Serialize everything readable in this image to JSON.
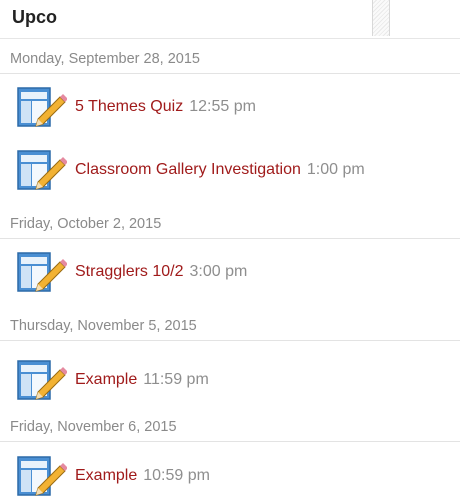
{
  "header": {
    "title": "Upco"
  },
  "groups": [
    {
      "date": "Monday, September 28, 2015",
      "events": [
        {
          "title": "5 Themes Quiz",
          "time": "12:55 pm",
          "icon": "assignment-icon"
        },
        {
          "title": "Classroom Gallery Investigation",
          "time": "1:00 pm",
          "icon": "assignment-icon"
        }
      ]
    },
    {
      "date": "Friday, October 2, 2015",
      "events": [
        {
          "title": "Stragglers 10/2",
          "time": "3:00 pm",
          "icon": "assignment-icon"
        }
      ]
    },
    {
      "date": "Thursday, November 5, 2015",
      "events": [
        {
          "title": "Example",
          "time": "11:59 pm",
          "icon": "assignment-icon"
        }
      ]
    },
    {
      "date": "Friday, November 6, 2015",
      "events": [
        {
          "title": "Example",
          "time": "10:59 pm",
          "icon": "assignment-icon"
        }
      ]
    }
  ],
  "colors": {
    "title": "#a01b1b",
    "time": "#8e8e8e",
    "date": "#8a8a8a"
  }
}
